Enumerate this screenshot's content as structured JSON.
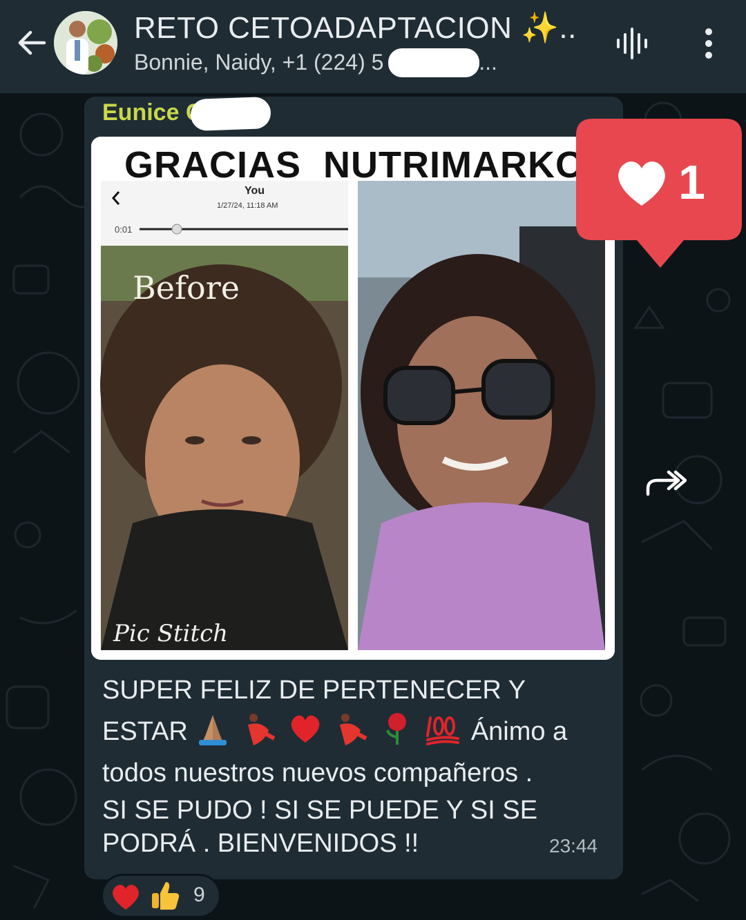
{
  "header": {
    "title": "RETO CETOADAPTACION ✨...",
    "subtitle": "Bonnie, Naidy, +1 (224) 5                   +1 (305) ...",
    "icons": [
      "back-arrow-icon",
      "group-avatar",
      "voice-call-icon",
      "more-options-icon"
    ]
  },
  "message": {
    "sender": "Eunice C",
    "image": {
      "title": "GRACIAS  NUTRIMARKO",
      "screenshot_user": "You",
      "screenshot_date": "1/27/24, 11:18 AM",
      "screenshot_time": "0:01",
      "before_label": "Before",
      "watermark": "Pic Stitch"
    },
    "text_line1": "SUPER FELIZ DE PERTENECER Y",
    "text_line2_start": "ESTAR",
    "text_line2_end": "Ánimo a",
    "text_line3": "todos nuestros nuevos compañeros .",
    "text_line4": "SI SE PUDO ! SI SE PUEDE Y SI SE",
    "text_line5": "PODRÁ . BIENVENIDOS !!",
    "emojis": [
      "folded-hands",
      "dancer",
      "red-heart",
      "dancer",
      "rose",
      "hundred-points"
    ],
    "time": "23:44"
  },
  "reactions": {
    "items": [
      "red-heart",
      "thumbs-up"
    ],
    "count": "9"
  },
  "like_badge": {
    "count": "1",
    "color": "#e8474f"
  },
  "colors": {
    "header_bg": "#1f2c34",
    "bubble_bg": "#1f2c34",
    "wallpaper_bg": "#0d1418",
    "sender_color": "#c9d84a",
    "text_color": "#e9edef"
  }
}
